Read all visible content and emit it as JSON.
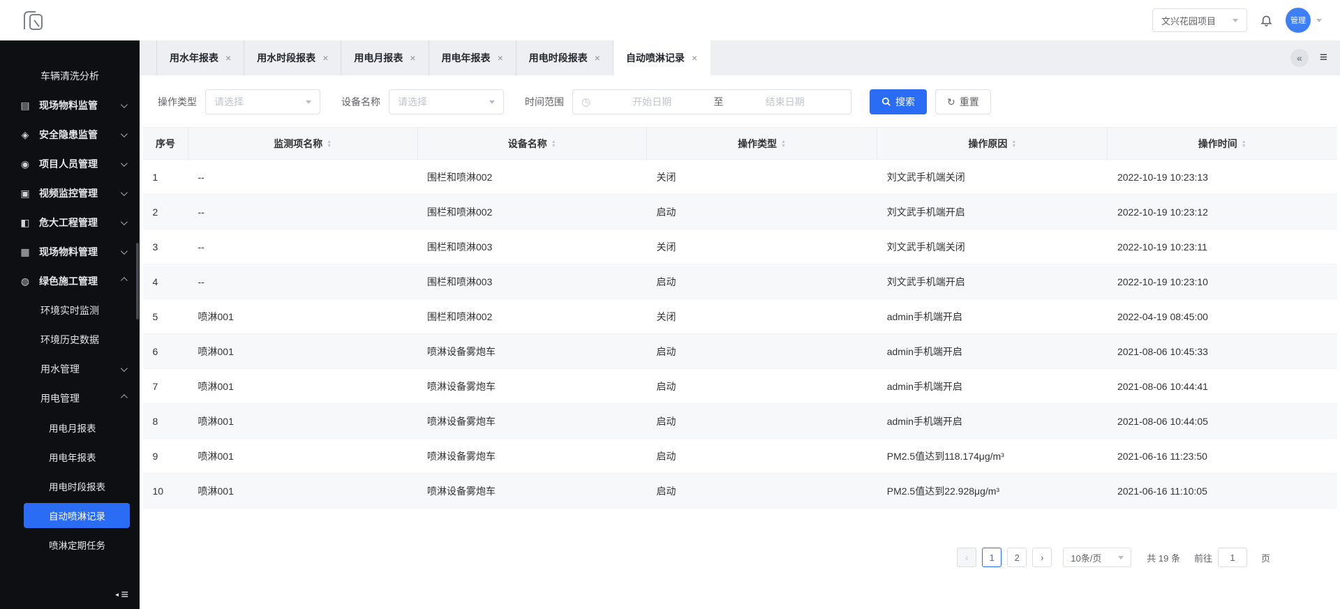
{
  "topbar": {
    "project": "文兴花园项目",
    "avatar": "管理"
  },
  "sidebar": {
    "items": [
      {
        "label": "车辆清洗分析",
        "depth": 2
      },
      {
        "label": "现场物料监管",
        "depth": 1,
        "icon": "materials-supervision-icon",
        "glyph": "▤",
        "chevron": "down"
      },
      {
        "label": "安全隐患监管",
        "depth": 1,
        "icon": "safety-hazard-icon",
        "glyph": "◈",
        "chevron": "down"
      },
      {
        "label": "项目人员管理",
        "depth": 1,
        "icon": "personnel-icon",
        "glyph": "◉",
        "chevron": "down"
      },
      {
        "label": "视频监控管理",
        "depth": 1,
        "icon": "video-monitor-icon",
        "glyph": "▣",
        "chevron": "down"
      },
      {
        "label": "危大工程管理",
        "depth": 1,
        "icon": "engineering-icon",
        "glyph": "◧",
        "chevron": "down"
      },
      {
        "label": "现场物料管理",
        "depth": 1,
        "icon": "materials-manage-icon",
        "glyph": "▦",
        "chevron": "down"
      },
      {
        "label": "绿色施工管理",
        "depth": 1,
        "icon": "green-construction-icon",
        "glyph": "◍",
        "chevron": "up"
      },
      {
        "label": "环境实时监测",
        "depth": 2
      },
      {
        "label": "环境历史数据",
        "depth": 2
      },
      {
        "label": "用水管理",
        "depth": 2,
        "chevron": "down"
      },
      {
        "label": "用电管理",
        "depth": 2,
        "chevron": "up"
      },
      {
        "label": "用电月报表",
        "depth": 3
      },
      {
        "label": "用电年报表",
        "depth": 3
      },
      {
        "label": "用电时段报表",
        "depth": 3
      },
      {
        "label": "自动喷淋记录",
        "depth": 3,
        "active": true
      },
      {
        "label": "喷淋定期任务",
        "depth": 3
      }
    ]
  },
  "tab_bar": {
    "close_glyph": "×",
    "scroll_left_glyph": "«",
    "menu_glyph": "≡",
    "tabs": [
      {
        "label": "用水年报表"
      },
      {
        "label": "用水时段报表"
      },
      {
        "label": "用电月报表"
      },
      {
        "label": "用电年报表"
      },
      {
        "label": "用电时段报表"
      },
      {
        "label": "自动喷淋记录",
        "active": true
      }
    ]
  },
  "filters": {
    "type_label": "操作类型",
    "type_placeholder": "请选择",
    "device_label": "设备名称",
    "device_placeholder": "请选择",
    "range_label": "时间范围",
    "clock_glyph": "◷",
    "start_placeholder": "开始日期",
    "to_text": "至",
    "end_placeholder": "结束日期",
    "search_label": "搜索",
    "reset_glyph": "↻",
    "reset_label": "重置"
  },
  "table": {
    "headers": [
      "序号",
      "监测项名称",
      "设备名称",
      "操作类型",
      "操作原因",
      "操作时间"
    ],
    "rows": [
      [
        "1",
        "--",
        "围栏和喷淋002",
        "关闭",
        "刘文武手机端关闭",
        "2022-10-19 10:23:13"
      ],
      [
        "2",
        "--",
        "围栏和喷淋002",
        "启动",
        "刘文武手机端开启",
        "2022-10-19 10:23:12"
      ],
      [
        "3",
        "--",
        "围栏和喷淋003",
        "关闭",
        "刘文武手机端关闭",
        "2022-10-19 10:23:11"
      ],
      [
        "4",
        "--",
        "围栏和喷淋003",
        "启动",
        "刘文武手机端开启",
        "2022-10-19 10:23:10"
      ],
      [
        "5",
        "喷淋001",
        "围栏和喷淋002",
        "关闭",
        "admin手机端开启",
        "2022-04-19 08:45:00"
      ],
      [
        "6",
        "喷淋001",
        "喷淋设备雾炮车",
        "启动",
        "admin手机端开启",
        "2021-08-06 10:45:33"
      ],
      [
        "7",
        "喷淋001",
        "喷淋设备雾炮车",
        "启动",
        "admin手机端开启",
        "2021-08-06 10:44:41"
      ],
      [
        "8",
        "喷淋001",
        "喷淋设备雾炮车",
        "启动",
        "admin手机端开启",
        "2021-08-06 10:44:05"
      ],
      [
        "9",
        "喷淋001",
        "喷淋设备雾炮车",
        "启动",
        "PM2.5值达到118.174μg/m³",
        "2021-06-16 11:23:50"
      ],
      [
        "10",
        "喷淋001",
        "喷淋设备雾炮车",
        "启动",
        "PM2.5值达到22.928μg/m³",
        "2021-06-16 11:10:05"
      ]
    ]
  },
  "pagination": {
    "prev_glyph": "‹",
    "next_glyph": "›",
    "pages": [
      "1",
      "2"
    ],
    "active_page": "1",
    "page_size": "10条/页",
    "total_text": "共 19 条",
    "goto_label": "前往",
    "goto_value": "1",
    "goto_suffix": "页"
  },
  "colors": {
    "accent": "#2a6cf4",
    "sidebar_bg": "#0d0f12",
    "tabstrip_bg": "#edeff2"
  }
}
